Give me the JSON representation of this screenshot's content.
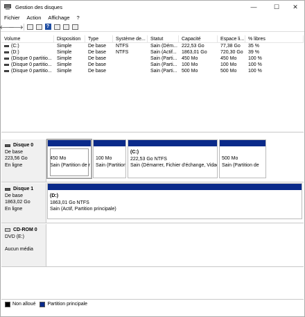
{
  "window": {
    "title": "Gestion des disques"
  },
  "menu": [
    "Fichier",
    "Action",
    "Affichage",
    "?"
  ],
  "controls": {
    "minimize": "—",
    "maximize": "☐",
    "close": "✕"
  },
  "toolbar": {
    "back": "🡐",
    "forward": "🡒",
    "help": "?"
  },
  "list": {
    "headers": [
      "Volume",
      "Disposition",
      "Type",
      "Système de...",
      "Statut",
      "Capacité",
      "Espace li...",
      "% libres"
    ],
    "rows": [
      {
        "volume": "(C:)",
        "disp": "Simple",
        "type": "De base",
        "fs": "NTFS",
        "stat": "Sain (Dém...",
        "cap": "222,53 Go",
        "free": "77,38 Go",
        "pct": "35 %"
      },
      {
        "volume": "(D:)",
        "disp": "Simple",
        "type": "De base",
        "fs": "NTFS",
        "stat": "Sain (Actif...",
        "cap": "1863,01 Go",
        "free": "720,30 Go",
        "pct": "39 %"
      },
      {
        "volume": "(Disque 0 partitio...",
        "disp": "Simple",
        "type": "De base",
        "fs": "",
        "stat": "Sain (Parti...",
        "cap": "450 Mo",
        "free": "450 Mo",
        "pct": "100 %"
      },
      {
        "volume": "(Disque 0 partitio...",
        "disp": "Simple",
        "type": "De base",
        "fs": "",
        "stat": "Sain (Parti...",
        "cap": "100 Mo",
        "free": "100 Mo",
        "pct": "100 %"
      },
      {
        "volume": "(Disque 0 partitio...",
        "disp": "Simple",
        "type": "De base",
        "fs": "",
        "stat": "Sain (Parti...",
        "cap": "500 Mo",
        "free": "500 Mo",
        "pct": "100 %"
      }
    ]
  },
  "disks": [
    {
      "name": "Disque 0",
      "type": "De base",
      "size": "223,56 Go",
      "status": "En ligne",
      "partitions": [
        {
          "title": "",
          "size": "450 Mo",
          "desc": "Sain (Partition de r"
        },
        {
          "title": "",
          "size": "100 Mo",
          "desc": "Sain (Partition du"
        },
        {
          "title": "(C:)",
          "size": "222,53 Go NTFS",
          "desc": "Sain (Démarrer, Fichier d'échange, Vidac"
        },
        {
          "title": "",
          "size": "500 Mo",
          "desc": "Sain (Partition de"
        }
      ]
    },
    {
      "name": "Disque 1",
      "type": "De base",
      "size": "1863,02 Go",
      "status": "En ligne",
      "partitions": [
        {
          "title": "(D:)",
          "size": "1863,01 Go NTFS",
          "desc": "Sain (Actif, Partition principale)"
        }
      ]
    },
    {
      "name": "CD-ROM 0",
      "type": "DVD (E:)",
      "size": "",
      "status": "Aucun média"
    }
  ],
  "legend": [
    {
      "label": "Non alloué",
      "color": "#000000"
    },
    {
      "label": "Partition principale",
      "color": "#0a2a8a"
    }
  ]
}
